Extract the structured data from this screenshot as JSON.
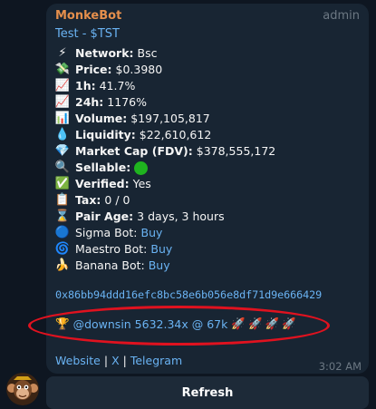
{
  "message": {
    "sender": "MonkeBot",
    "role": "admin",
    "token_title": "Test - $TST",
    "rows": [
      {
        "icon": "lightning-icon",
        "glyph": "⚡",
        "label": "Network:",
        "value": "Bsc"
      },
      {
        "icon": "money-icon",
        "glyph": "💸",
        "label": "Price:",
        "value": "$0.3980"
      },
      {
        "icon": "chart-up-icon",
        "glyph": "📈",
        "label": "1h:",
        "value": "41.7%"
      },
      {
        "icon": "chart-up-icon",
        "glyph": "📈",
        "label": "24h:",
        "value": "1176%"
      },
      {
        "icon": "bar-chart-icon",
        "glyph": "📊",
        "label": "Volume:",
        "value": "$197,105,817"
      },
      {
        "icon": "droplet-icon",
        "glyph": "💧",
        "label": "Liquidity:",
        "value": "$22,610,612"
      },
      {
        "icon": "gem-icon",
        "glyph": "💎",
        "label": "Market Cap (FDV):",
        "value": "$378,555,172"
      },
      {
        "icon": "magnifier-icon",
        "glyph": "🔍",
        "label": "Sellable:",
        "value": ""
      },
      {
        "icon": "check-icon",
        "glyph": "✅",
        "label": "Verified:",
        "value": "Yes"
      },
      {
        "icon": "receipt-icon",
        "glyph": "📋",
        "label": "Tax:",
        "value": "0 / 0"
      },
      {
        "icon": "hourglass-icon",
        "glyph": "⌛",
        "label": "Pair Age:",
        "value": "3 days, 3 hours"
      }
    ],
    "bots": [
      {
        "icon": "blue-circle-icon",
        "glyph": "🔵",
        "label": "Sigma Bot:",
        "link": "Buy"
      },
      {
        "icon": "cyclone-icon",
        "glyph": "🌀",
        "label": "Maestro Bot:",
        "link": "Buy"
      },
      {
        "icon": "banana-icon",
        "glyph": "🍌",
        "label": "Banana Bot:",
        "link": "Buy"
      }
    ],
    "contract_address": "0x86bb94ddd16efc8bc58e6b056e8df71d9e666429",
    "highlight": {
      "trophy_glyph": "🏆",
      "text": "@downsin 5632.34x @ 67k",
      "rockets": [
        "🚀",
        "🚀",
        "🚀",
        "🚀"
      ]
    },
    "links": [
      "Website",
      "X",
      "Telegram"
    ],
    "link_separator": "|",
    "time": "3:02 AM"
  },
  "actions": {
    "refresh_label": "Refresh"
  },
  "colors": {
    "background": "#0e1621",
    "bubble": "#182533",
    "sender": "#e58f4c",
    "link": "#6ab3f3",
    "highlight_oval": "#e0121f"
  }
}
